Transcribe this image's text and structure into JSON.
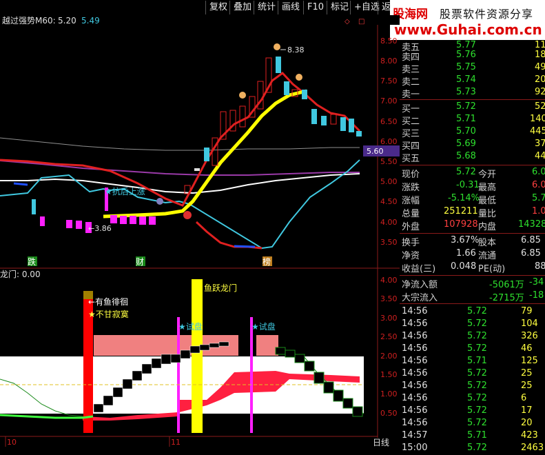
{
  "toolbar": {
    "buttons": [
      "复权",
      "叠加",
      "统计",
      "画线",
      "F10",
      "标记",
      "+自选",
      "返回"
    ]
  },
  "logo": {
    "brand": "股海网",
    "tagline": "股票软件资源分享",
    "url": "www.Guhai.com.cn"
  },
  "main_chart": {
    "title": "越过强势M60:",
    "val1": "5.20",
    "val2": "5.49",
    "price_axis": [
      "8.50",
      "8.00",
      "7.50",
      "7.00",
      "6.50",
      "6.00",
      "5.50",
      "5.00",
      "4.50",
      "4.00",
      "3.50"
    ],
    "current_price_tag": "5.60",
    "high_label": "8.38",
    "low_label": "3.86",
    "annotation_rise": "★抗后上涨",
    "marker_die": "跌",
    "marker_cai": "财",
    "marker_bang": "榜",
    "colors": {
      "red_line": "#e02020",
      "yellow_line": "#ffff00",
      "cyan_line": "#40c8e0",
      "magenta": "#ff20ff",
      "white_line": "#ffffff",
      "purple": "#9a3aa8"
    }
  },
  "sub_chart": {
    "title": "龙门: 0.00",
    "axis": [
      "4.00",
      "3.50",
      "3.00",
      "2.50",
      "2.00",
      "1.50",
      "1.00",
      "0.50"
    ],
    "label_yugu": "←有鱼徘徊",
    "label_buganjimo": "★不甘寂寞",
    "label_yuyue": "鱼跃龙门",
    "label_shipan1": "★试盘",
    "label_shipan2": "★试盘",
    "date_axis": [
      "10",
      "11"
    ],
    "period": "日线"
  },
  "quote": {
    "asks": [
      {
        "label": "卖五",
        "price": "5.77",
        "vol": "11"
      },
      {
        "label": "卖四",
        "price": "5.76",
        "vol": "18"
      },
      {
        "label": "卖三",
        "price": "5.75",
        "vol": "49"
      },
      {
        "label": "卖二",
        "price": "5.74",
        "vol": "20"
      },
      {
        "label": "卖一",
        "price": "5.73",
        "vol": "92"
      }
    ],
    "bids": [
      {
        "label": "买一",
        "price": "5.72",
        "vol": "52"
      },
      {
        "label": "买二",
        "price": "5.71",
        "vol": "140"
      },
      {
        "label": "买三",
        "price": "5.70",
        "vol": "445"
      },
      {
        "label": "买四",
        "price": "5.69",
        "vol": "37"
      },
      {
        "label": "买五",
        "price": "5.68",
        "vol": "44"
      }
    ],
    "stats": [
      {
        "l1": "现价",
        "v1": "5.72",
        "l2": "今开",
        "v2": "6.0"
      },
      {
        "l1": "涨跌",
        "v1": "-0.31",
        "l2": "最高",
        "v2": "6.0"
      },
      {
        "l1": "涨幅",
        "v1": "-5.14%",
        "l2": "最低",
        "v2": "5.7"
      },
      {
        "l1": "总量",
        "v1": "251211",
        "l2": "量比",
        "v2": "1.0"
      },
      {
        "l1": "外盘",
        "v1": "107928",
        "l2": "内盘",
        "v2": "14328"
      }
    ],
    "stats2": [
      {
        "l1": "换手",
        "v1": "3.67%",
        "l2": "股本",
        "v2": "6.85"
      },
      {
        "l1": "净资",
        "v1": "1.66",
        "l2": "流通",
        "v2": "6.85"
      },
      {
        "l1": "收益(三)",
        "v1": "0.048",
        "l2": "PE(动)",
        "v2": "88"
      }
    ],
    "flow": [
      {
        "label": "净流入额",
        "v1": "-5061万",
        "v2": "-34"
      },
      {
        "label": "大宗流入",
        "v1": "-2715万",
        "v2": "-18"
      }
    ],
    "ticks": [
      {
        "t": "14:56",
        "p": "5.72",
        "v": "79"
      },
      {
        "t": "14:56",
        "p": "5.72",
        "v": "104"
      },
      {
        "t": "14:56",
        "p": "5.72",
        "v": "326"
      },
      {
        "t": "14:56",
        "p": "5.72",
        "v": "46"
      },
      {
        "t": "14:56",
        "p": "5.71",
        "v": "125"
      },
      {
        "t": "14:56",
        "p": "5.72",
        "v": "25"
      },
      {
        "t": "14:56",
        "p": "5.72",
        "v": "25"
      },
      {
        "t": "14:56",
        "p": "5.72",
        "v": "6"
      },
      {
        "t": "14:56",
        "p": "5.72",
        "v": "17"
      },
      {
        "t": "14:56",
        "p": "5.72",
        "v": "20"
      },
      {
        "t": "14:57",
        "p": "5.71",
        "v": "423"
      },
      {
        "t": "15:00",
        "p": "5.72",
        "v": "2463"
      }
    ]
  }
}
